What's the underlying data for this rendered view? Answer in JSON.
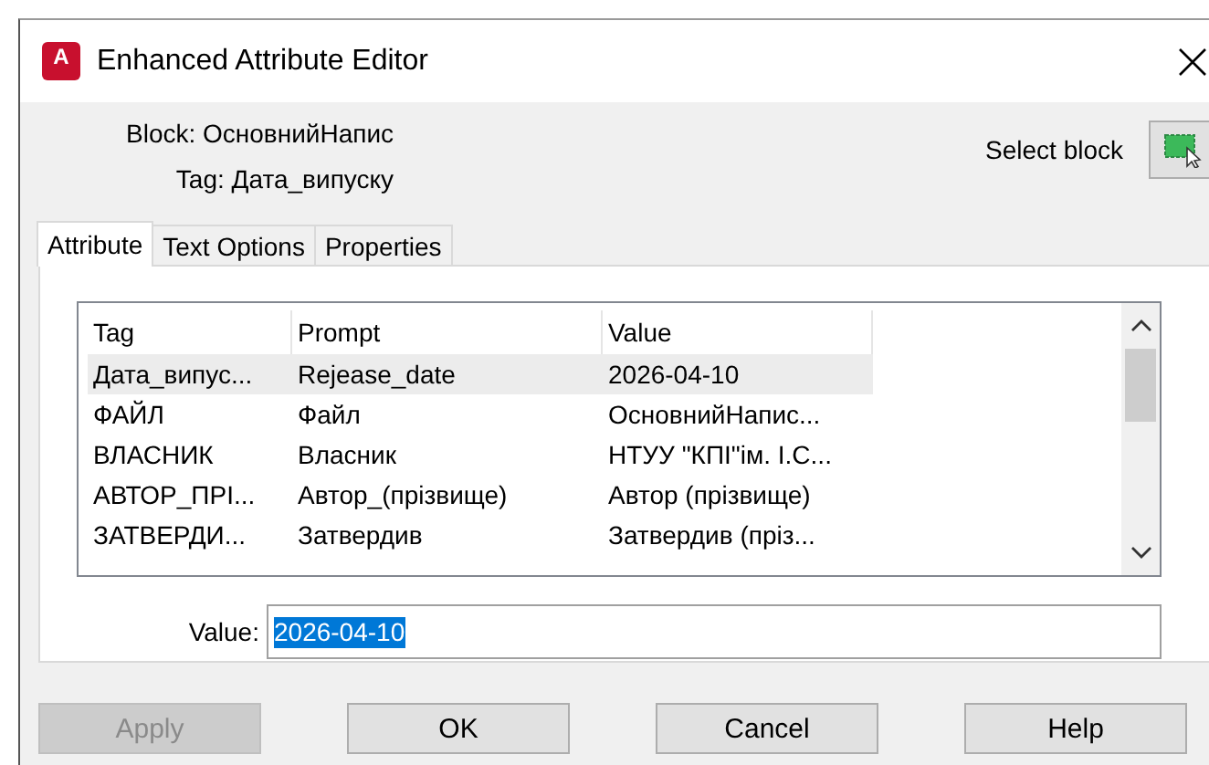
{
  "window": {
    "title": "Enhanced Attribute Editor",
    "icon_label": "A"
  },
  "block": "Block: ОсновнийНапис",
  "tag": "Tag: Дата_випуску",
  "select_block": {
    "label": "Select block"
  },
  "tabs": [
    {
      "label": "Attribute",
      "selected": true
    },
    {
      "label": "Text Options",
      "selected": false
    },
    {
      "label": "Properties",
      "selected": false
    }
  ],
  "table": {
    "columns": [
      "Tag",
      "Prompt",
      "Value"
    ],
    "rows": [
      {
        "cells": [
          "Дата_випус...",
          "Rejease_date",
          "2026-04-10"
        ],
        "selected": true
      },
      {
        "cells": [
          "ФАЙЛ",
          "Файл",
          "ОсновнийНапис..."
        ],
        "selected": false
      },
      {
        "cells": [
          "ВЛАСНИК",
          "Власник",
          "НТУУ \"КПІ\"ім. І.С..."
        ],
        "selected": false
      },
      {
        "cells": [
          "АВТОР_ПРІ...",
          "Автор_(прізвище)",
          "Автор (прізвище)"
        ],
        "selected": false
      },
      {
        "cells": [
          "ЗАТВЕРДИ...",
          "Затвердив",
          "Затвердив (пріз..."
        ],
        "selected": false
      }
    ]
  },
  "value_field": {
    "label": "Value:",
    "value": "2026-04-10",
    "text_selected": true
  },
  "buttons": [
    {
      "label": "Apply",
      "disabled": true
    },
    {
      "label": "OK",
      "disabled": false
    },
    {
      "label": "Cancel",
      "disabled": false
    },
    {
      "label": "Help",
      "disabled": false
    }
  ]
}
